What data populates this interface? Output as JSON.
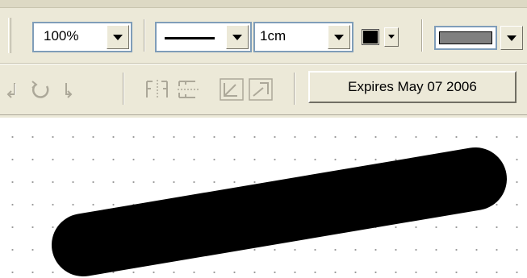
{
  "toolbar": {
    "zoom": {
      "value": "100%"
    },
    "line_style": {
      "icon": "solid-line"
    },
    "line_width": {
      "value": "1cm"
    },
    "line_color": {
      "color": "#000000"
    },
    "fill_color": {
      "color": "#808080"
    },
    "license_button": {
      "label": "Expires May 07 2006"
    }
  },
  "row2_icons": [
    "rotate-left-icon",
    "rotate-icon",
    "rotate-right-icon",
    "flip-horizontal-icon",
    "flip-vertical-icon",
    "align-left-icon",
    "align-right-icon"
  ],
  "canvas": {
    "shape": "thick-line",
    "stroke_color": "#000000"
  }
}
